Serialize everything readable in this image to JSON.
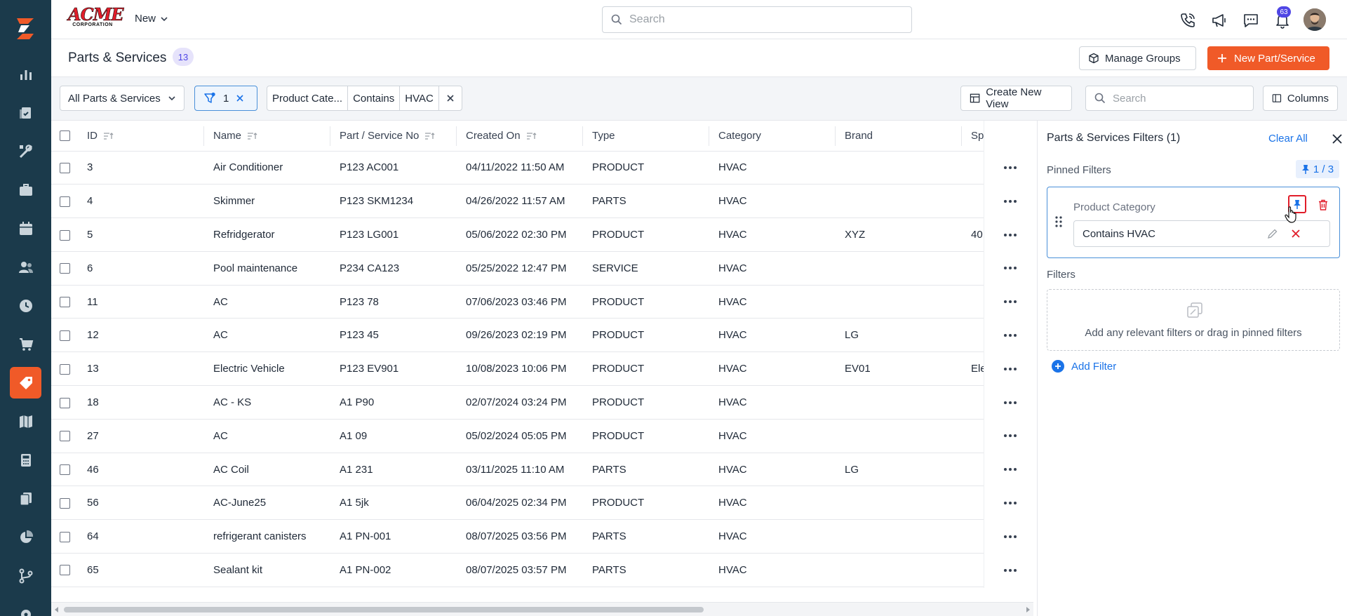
{
  "brand": {
    "name": "ACME",
    "sub": "CORPORATION"
  },
  "topbar": {
    "new_label": "New",
    "search_placeholder": "Search",
    "notifications_count": "63"
  },
  "page": {
    "title": "Parts & Services",
    "count": "13",
    "manage_groups": "Manage Groups",
    "new_part": "New Part/Service"
  },
  "toolbar": {
    "view": "All Parts & Services",
    "filter_count": "1",
    "chip": {
      "field": "Product Cate...",
      "operator": "Contains",
      "value": "HVAC"
    },
    "create_view": "Create New View",
    "search_placeholder": "Search",
    "columns": "Columns"
  },
  "table": {
    "headers": {
      "id": "ID",
      "name": "Name",
      "part_no": "Part / Service No",
      "created": "Created On",
      "type": "Type",
      "category": "Category",
      "brand": "Brand",
      "sp": "Sp"
    },
    "rows": [
      {
        "id": "3",
        "name": "Air Conditioner",
        "part_no": "P123 AC001",
        "created": "04/11/2022 11:50 AM",
        "type": "PRODUCT",
        "category": "HVAC",
        "brand": "",
        "sp": ""
      },
      {
        "id": "4",
        "name": "Skimmer",
        "part_no": "P123 SKM1234",
        "created": "04/26/2022 11:57 AM",
        "type": "PARTS",
        "category": "HVAC",
        "brand": "",
        "sp": ""
      },
      {
        "id": "5",
        "name": "Refridgerator",
        "part_no": "P123 LG001",
        "created": "05/06/2022 02:30 PM",
        "type": "PRODUCT",
        "category": "HVAC",
        "brand": "XYZ",
        "sp": "40"
      },
      {
        "id": "6",
        "name": "Pool maintenance",
        "part_no": "P234 CA123",
        "created": "05/25/2022 12:47 PM",
        "type": "SERVICE",
        "category": "HVAC",
        "brand": "",
        "sp": ""
      },
      {
        "id": "11",
        "name": "AC",
        "part_no": "P123 78",
        "created": "07/06/2023 03:46 PM",
        "type": "PRODUCT",
        "category": "HVAC",
        "brand": "",
        "sp": ""
      },
      {
        "id": "12",
        "name": "AC",
        "part_no": "P123 45",
        "created": "09/26/2023 02:19 PM",
        "type": "PRODUCT",
        "category": "HVAC",
        "brand": "LG",
        "sp": ""
      },
      {
        "id": "13",
        "name": "Electric Vehicle",
        "part_no": "P123 EV901",
        "created": "10/08/2023 10:06 PM",
        "type": "PRODUCT",
        "category": "HVAC",
        "brand": "EV01",
        "sp": "Ele"
      },
      {
        "id": "18",
        "name": "AC - KS",
        "part_no": "A1 P90",
        "created": "02/07/2024 03:24 PM",
        "type": "PRODUCT",
        "category": "HVAC",
        "brand": "",
        "sp": ""
      },
      {
        "id": "27",
        "name": "AC",
        "part_no": "A1 09",
        "created": "05/02/2024 05:05 PM",
        "type": "PRODUCT",
        "category": "HVAC",
        "brand": "",
        "sp": ""
      },
      {
        "id": "46",
        "name": "AC Coil",
        "part_no": "A1 231",
        "created": "03/11/2025 11:10 AM",
        "type": "PARTS",
        "category": "HVAC",
        "brand": "LG",
        "sp": ""
      },
      {
        "id": "56",
        "name": "AC-June25",
        "part_no": "A1 5jk",
        "created": "06/04/2025 02:34 PM",
        "type": "PRODUCT",
        "category": "HVAC",
        "brand": "",
        "sp": ""
      },
      {
        "id": "64",
        "name": "refrigerant canisters",
        "part_no": "A1 PN-001",
        "created": "08/07/2025 03:56 PM",
        "type": "PARTS",
        "category": "HVAC",
        "brand": "",
        "sp": ""
      },
      {
        "id": "65",
        "name": "Sealant kit",
        "part_no": "A1 PN-002",
        "created": "08/07/2025 03:57 PM",
        "type": "PARTS",
        "category": "HVAC",
        "brand": "",
        "sp": ""
      }
    ]
  },
  "panel": {
    "title": "Parts & Services Filters (1)",
    "clear_all": "Clear All",
    "pinned_label": "Pinned Filters",
    "pinned_counter": "1 / 3",
    "pinned_filter": {
      "label": "Product Category",
      "value": "Contains HVAC"
    },
    "filters_label": "Filters",
    "drop_text": "Add any relevant filters or drag in pinned filters",
    "add_filter": "Add Filter"
  },
  "colors": {
    "sidebar": "#1b3a4b",
    "accent": "#f05a28",
    "link": "#1a73e8"
  },
  "icons": [
    "logo-icon",
    "reports-icon",
    "jobs-icon",
    "tools-icon",
    "briefcase-icon",
    "calendar-icon",
    "customers-icon",
    "clock-icon",
    "cart-icon",
    "tag-icon",
    "map-icon",
    "calculator-icon",
    "documents-icon",
    "pie-chart-icon",
    "workflow-icon",
    "phone-icon",
    "megaphone-icon",
    "chat-icon",
    "bell-icon"
  ]
}
